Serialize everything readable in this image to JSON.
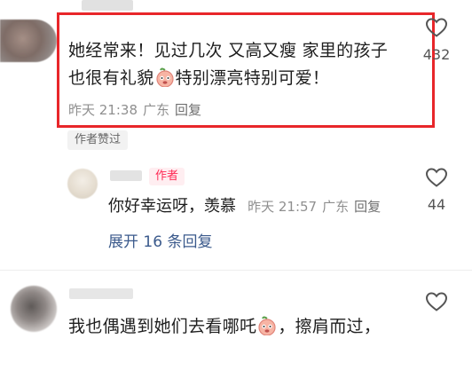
{
  "comment1": {
    "line1": "她经常来！见过几次 又高又瘦 家里的孩子",
    "line2_before": "也很有礼貌",
    "line2_after": "特别漂亮特别可爱！",
    "time": "昨天 21:38",
    "location": "广东",
    "reply_label": "回复",
    "like_count": "432",
    "badge": "作者赞过"
  },
  "reply": {
    "author_tag": "作者",
    "text": "你好幸运呀，羡慕",
    "time": "昨天 21:57",
    "location": "广东",
    "reply_label": "回复",
    "like_count": "44",
    "expand_label": "展开 16 条回复"
  },
  "comment2": {
    "text_before": "我也偶遇到她们去看哪吒",
    "text_after": "，擦肩而过，"
  },
  "icons": {
    "like": "heart-outline-icon",
    "emoji": "peach-face-emoji"
  },
  "colors": {
    "highlight_border": "#e8262a",
    "author_tag": "#ff2a55",
    "link": "#3b5a8c",
    "meta": "#8f8f8f"
  }
}
